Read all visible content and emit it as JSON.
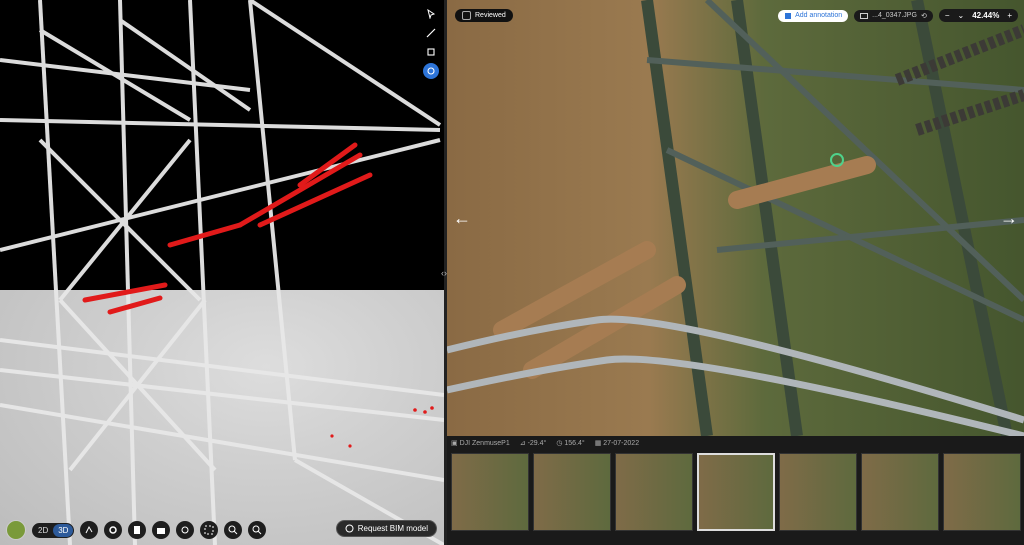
{
  "left_panel": {
    "tools": [
      {
        "icon": "cursor-icon"
      },
      {
        "icon": "measure-line-icon"
      },
      {
        "icon": "crop-box-icon"
      },
      {
        "icon": "target-icon",
        "active": true
      }
    ],
    "bottom": {
      "toggle_2d": "2D",
      "toggle_3d": "3D",
      "active_mode": "3D",
      "icons": [
        "route-icon",
        "settings-icon",
        "book-icon",
        "camera-icon",
        "locate-icon",
        "fit-icon",
        "zoom-in-icon",
        "zoom-out-icon"
      ]
    },
    "request_bim": "Request BIM model"
  },
  "right_panel": {
    "reviewed_label": "Reviewed",
    "add_annotation": "Add annotation",
    "file_name": "...4_0347.JPG",
    "zoom": "42.44%",
    "meta": {
      "camera": "DJI ZenmuseP1",
      "pitch": "-29.4°",
      "heading": "156.4°",
      "date": "27-07-2022"
    },
    "thumbnail_count": 7,
    "selected_thumbnail": 4
  },
  "colors": {
    "accent": "#2d74d8",
    "highlight_points": "#e11a1a",
    "point_cloud": "#e6e6e6"
  }
}
